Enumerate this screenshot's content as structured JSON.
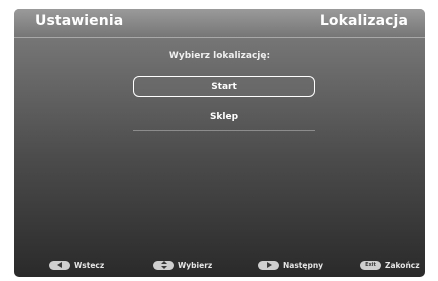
{
  "header": {
    "left_title": "Ustawienia",
    "right_title": "Lokalizacja"
  },
  "main": {
    "prompt": "Wybierz lokalizację:",
    "options": [
      {
        "label": "Start",
        "selected": true
      },
      {
        "label": "Sklep",
        "selected": false
      }
    ]
  },
  "footer": {
    "hints": [
      {
        "icon": "left-arrow-icon",
        "label": "Wstecz"
      },
      {
        "icon": "up-down-arrow-icon",
        "label": "Wybierz"
      },
      {
        "icon": "right-arrow-icon",
        "label": "Następny"
      },
      {
        "icon": "exit-key-icon",
        "key_text": "Exit",
        "label": "Zakończ"
      }
    ]
  },
  "colors": {
    "header_background": "#8a8a8a",
    "panel_top": "#808080",
    "panel_bottom": "#2a2a2a",
    "text": "#ffffff",
    "key_background": "#cfcfcf"
  }
}
